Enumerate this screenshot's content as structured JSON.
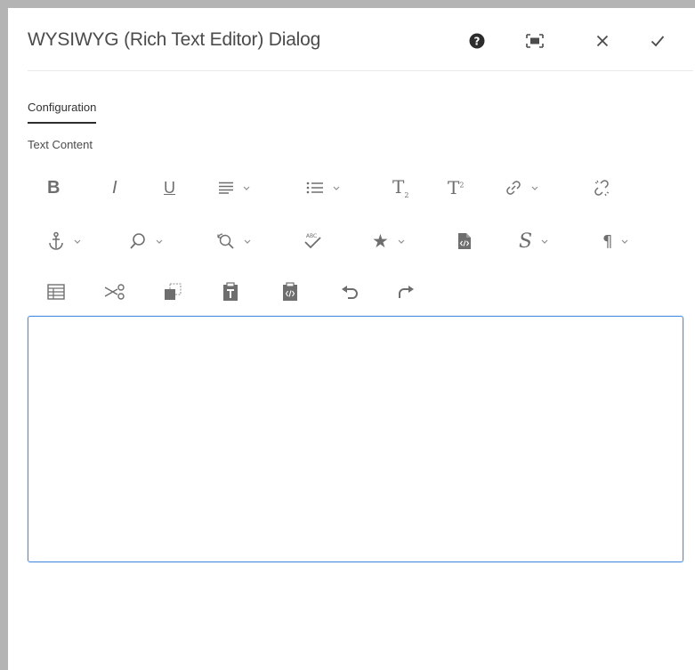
{
  "dialog": {
    "title": "WYSIWYG (Rich Text Editor) Dialog",
    "header_buttons": [
      {
        "name": "help-icon",
        "label": "Help"
      },
      {
        "name": "fullscreen-icon",
        "label": "Toggle fullscreen"
      },
      {
        "name": "close-icon",
        "label": "Cancel"
      },
      {
        "name": "check-icon",
        "label": "Done"
      }
    ]
  },
  "tabs": [
    {
      "label": "Configuration",
      "active": true
    }
  ],
  "field": {
    "label": "Text Content",
    "value": ""
  },
  "toolbar": {
    "row1": [
      "bold-icon",
      "italic-icon",
      "underline-icon",
      "align-icon",
      "list-icon",
      "subscript-icon",
      "superscript-icon",
      "link-icon",
      "unlink-icon"
    ],
    "row2": [
      "anchor-icon",
      "find-icon",
      "find-replace-icon",
      "spellcheck-icon",
      "special-char-icon",
      "source-edit-icon",
      "styles-icon",
      "paragraph-format-icon"
    ],
    "row3": [
      "table-icon",
      "cut-icon",
      "copy-icon",
      "paste-text-icon",
      "paste-word-icon",
      "undo-icon",
      "redo-icon"
    ],
    "glyphs": {
      "bold": "B",
      "italic": "I",
      "underline": "U",
      "subscript": "T",
      "subscript_mark": "2",
      "superscript": "T",
      "superscript_mark": "2",
      "styles": "S",
      "paragraph": "¶",
      "special_char": "★",
      "spellcheck_mark": "ABC"
    }
  },
  "colors": {
    "frame": "#b4b4b4",
    "icon": "#6e6e6e",
    "focus_border": "#4b8fe3",
    "title_text": "#4b4b4b"
  }
}
